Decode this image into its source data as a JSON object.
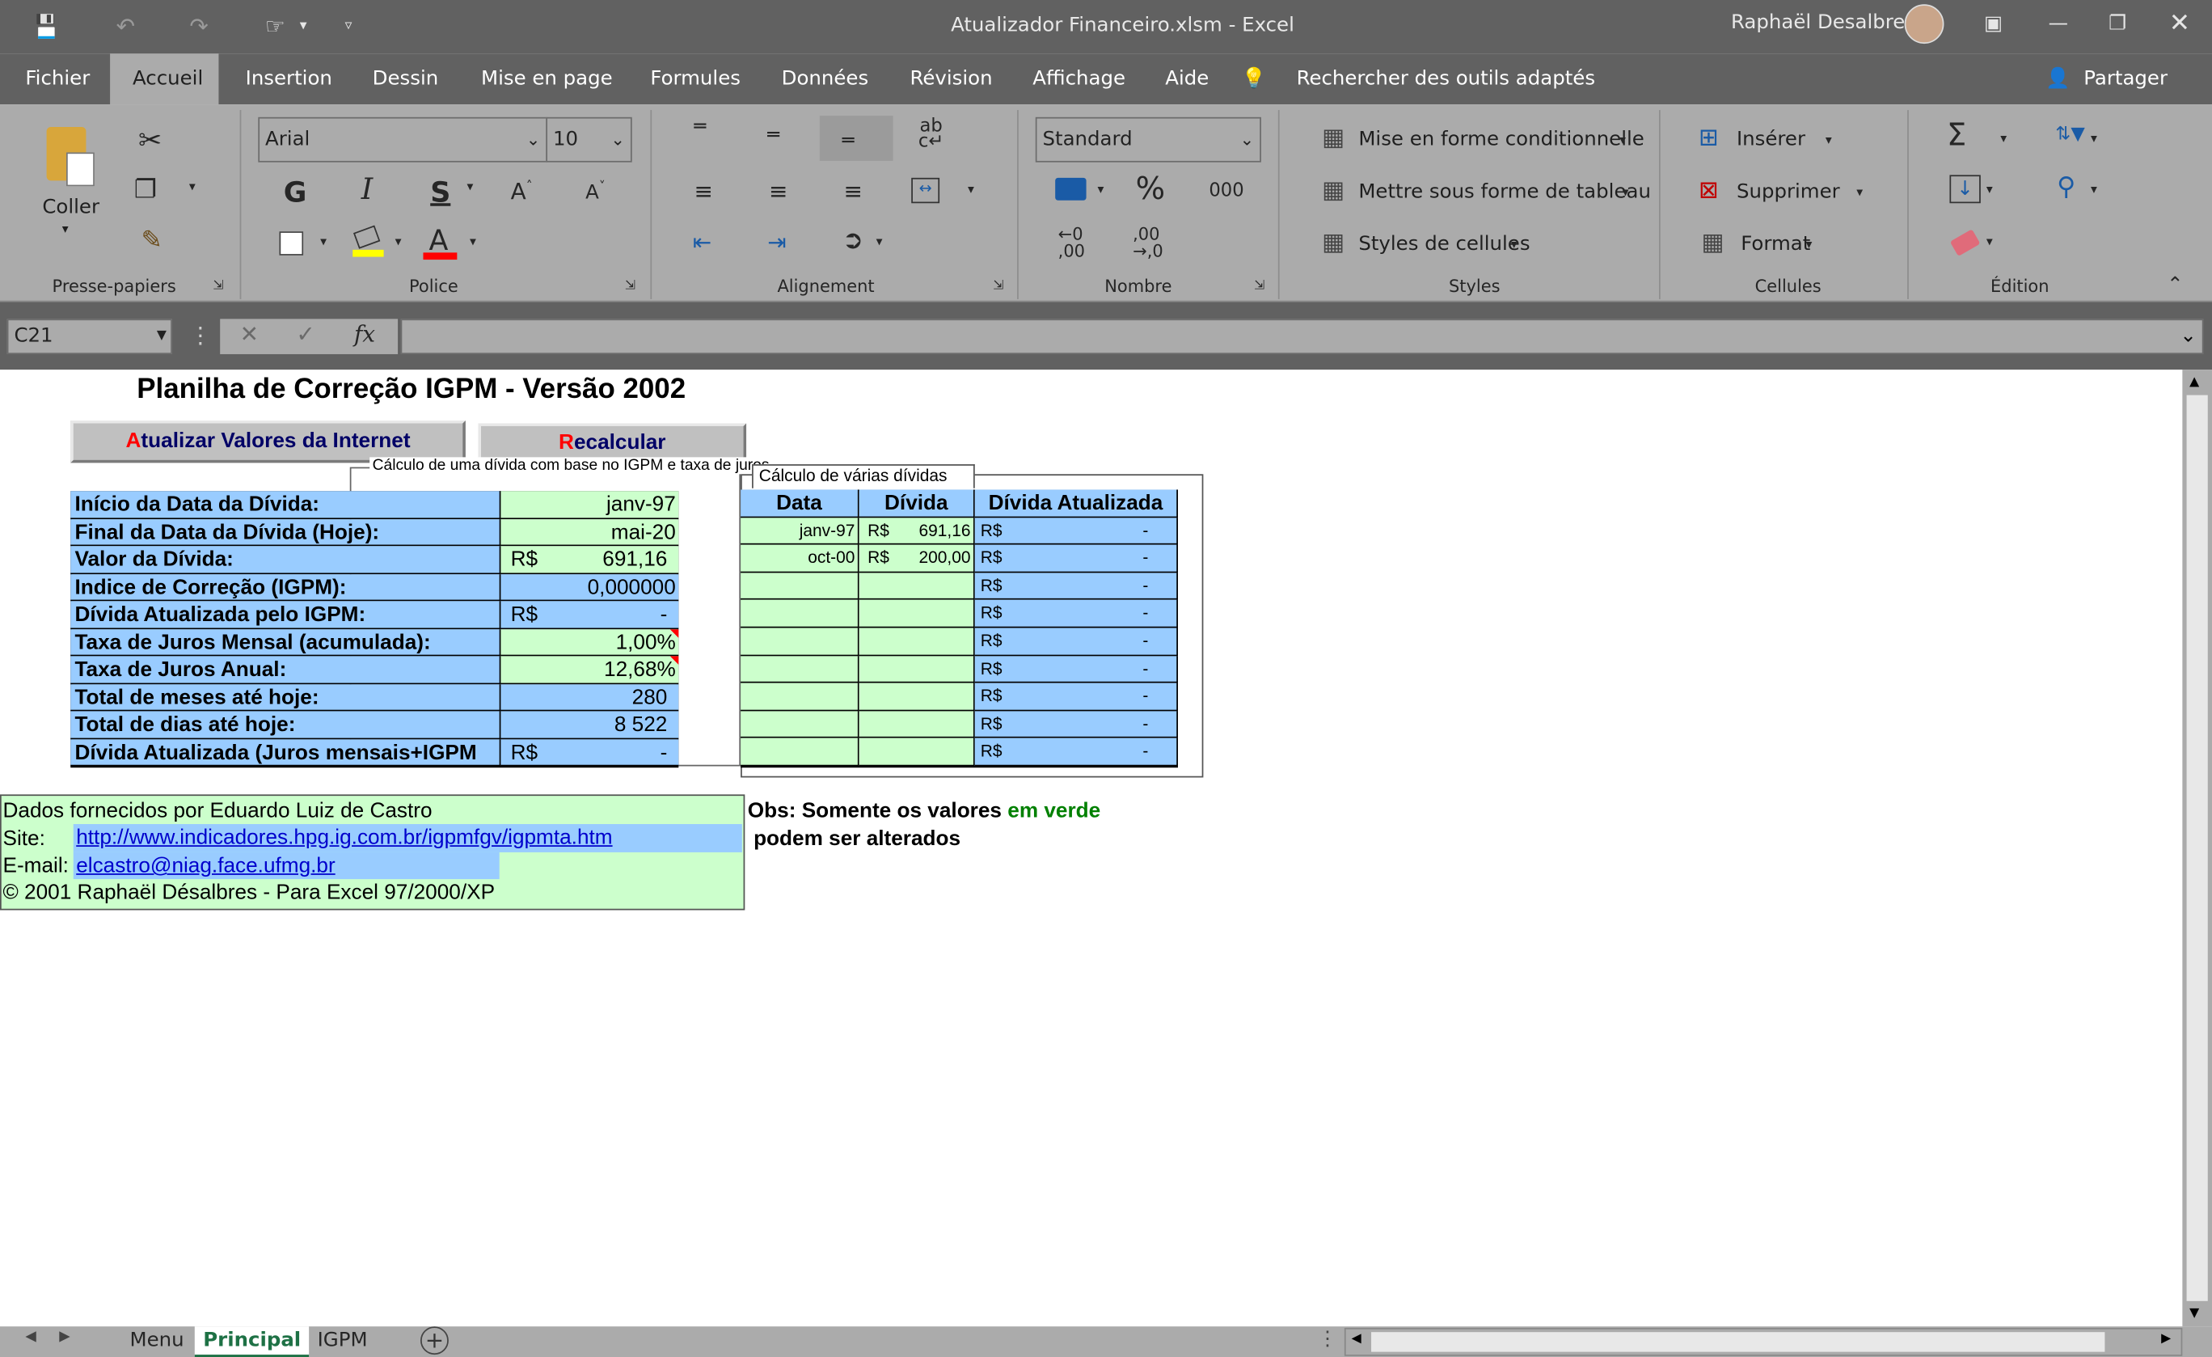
{
  "window": {
    "title": "Atualizador Financeiro.xlsm  -  Excel",
    "user": "Raphaël Desalbres"
  },
  "tabs": {
    "file": "Fichier",
    "home": "Accueil",
    "insert": "Insertion",
    "draw": "Dessin",
    "layout": "Mise en page",
    "formulas": "Formules",
    "data": "Données",
    "review": "Révision",
    "view": "Affichage",
    "help": "Aide",
    "search": "Rechercher des outils adaptés",
    "share": "Partager"
  },
  "ribbon": {
    "clipboard": {
      "paste": "Coller",
      "label": "Presse-papiers"
    },
    "font": {
      "name": "Arial",
      "size": "10",
      "label": "Police",
      "bold": "G",
      "italic": "I",
      "underline": "S"
    },
    "alignment": {
      "label": "Alignement"
    },
    "number": {
      "format": "Standard",
      "label": "Nombre",
      "percent": "%",
      "thousands": "000",
      "dec_inc_top": "←0",
      "dec_inc_bot": ",00",
      "dec_dec_top": ",00",
      "dec_dec_bot": "→,0"
    },
    "styles": {
      "conditional": "Mise en forme conditionnelle",
      "table": "Mettre sous forme de tableau",
      "cell_styles": "Styles de cellules",
      "label": "Styles"
    },
    "cells": {
      "insert": "Insérer",
      "delete": "Supprimer",
      "format": "Format",
      "label": "Cellules"
    },
    "editing": {
      "label": "Édition"
    }
  },
  "formula_bar": {
    "name_box": "C21",
    "formula": "",
    "fx": "fx"
  },
  "sheet": {
    "title": "Planilha de Correção IGPM - Versão 2002",
    "btn_update_first": "A",
    "btn_update_rest": "tualizar Valores da Internet",
    "btn_recalc_first": "R",
    "btn_recalc_rest": "ecalcular",
    "calc_caption": "Cálculo de uma dívida com base no IGPM e taxa de juros",
    "multi_caption": "Cálculo de várias dívidas",
    "rows": [
      {
        "label": "Início da Data da Dívida:",
        "cur": "",
        "value": "janv-97"
      },
      {
        "label": "Final da Data da Dívida (Hoje):",
        "cur": "",
        "value": "mai-20"
      },
      {
        "label": "Valor da Dívida:",
        "cur": "R$",
        "value": "691,16"
      },
      {
        "label": "Indice de Correção (IGPM):",
        "cur": "",
        "value": "0,000000"
      },
      {
        "label": "Dívida Atualizada pelo IGPM:",
        "cur": "R$",
        "value": "-"
      },
      {
        "label": "Taxa de Juros Mensal (acumulada):",
        "cur": "",
        "value": "1,00%"
      },
      {
        "label": "Taxa de Juros Anual:",
        "cur": "",
        "value": "12,68%"
      },
      {
        "label": "Total de meses até hoje:",
        "cur": "",
        "value": "280"
      },
      {
        "label": "Total de dias até hoje:",
        "cur": "",
        "value": "8 522"
      },
      {
        "label": "Dívida Atualizada (Juros mensais+IGPM",
        "cur": "R$",
        "value": "-"
      }
    ],
    "multi": {
      "headers": [
        "Data",
        "Dívida",
        "Dívida Atualizada"
      ],
      "rows": [
        {
          "date": "janv-97",
          "cur": "R$",
          "amount": "691,16",
          "ucur": "R$",
          "updated": "-"
        },
        {
          "date": "oct-00",
          "cur": "R$",
          "amount": "200,00",
          "ucur": "R$",
          "updated": "-"
        },
        {
          "date": "",
          "cur": "",
          "amount": "",
          "ucur": "R$",
          "updated": "-"
        },
        {
          "date": "",
          "cur": "",
          "amount": "",
          "ucur": "R$",
          "updated": "-"
        },
        {
          "date": "",
          "cur": "",
          "amount": "",
          "ucur": "R$",
          "updated": "-"
        },
        {
          "date": "",
          "cur": "",
          "amount": "",
          "ucur": "R$",
          "updated": "-"
        },
        {
          "date": "",
          "cur": "",
          "amount": "",
          "ucur": "R$",
          "updated": "-"
        },
        {
          "date": "",
          "cur": "",
          "amount": "",
          "ucur": "R$",
          "updated": "-"
        },
        {
          "date": "",
          "cur": "",
          "amount": "",
          "ucur": "R$",
          "updated": "-"
        }
      ]
    },
    "credits": {
      "line1": "Dados fornecidos por Eduardo Luiz de Castro",
      "site_label": "Site:",
      "site_url": "http://www.indicadores.hpg.ig.com.br/igpmfgv/igpmta.htm",
      "email_label": "E-mail:",
      "email": "elcastro@niag.face.ufmg.br",
      "copyright": "© 2001 Raphaël Désalbres - Para Excel 97/2000/XP"
    },
    "obs": {
      "part1": "Obs: Somente os valores ",
      "green": "em verde",
      "line2": " podem ser alterados"
    }
  },
  "sheet_tabs": [
    "Menu",
    "Principal",
    "IGPM"
  ],
  "colors": {
    "blue_cell": "#99ccff",
    "green_cell": "#ccffcc",
    "ribbon": "#ababab",
    "titlebar": "#616161",
    "active_tab_text": "#1e7145"
  }
}
